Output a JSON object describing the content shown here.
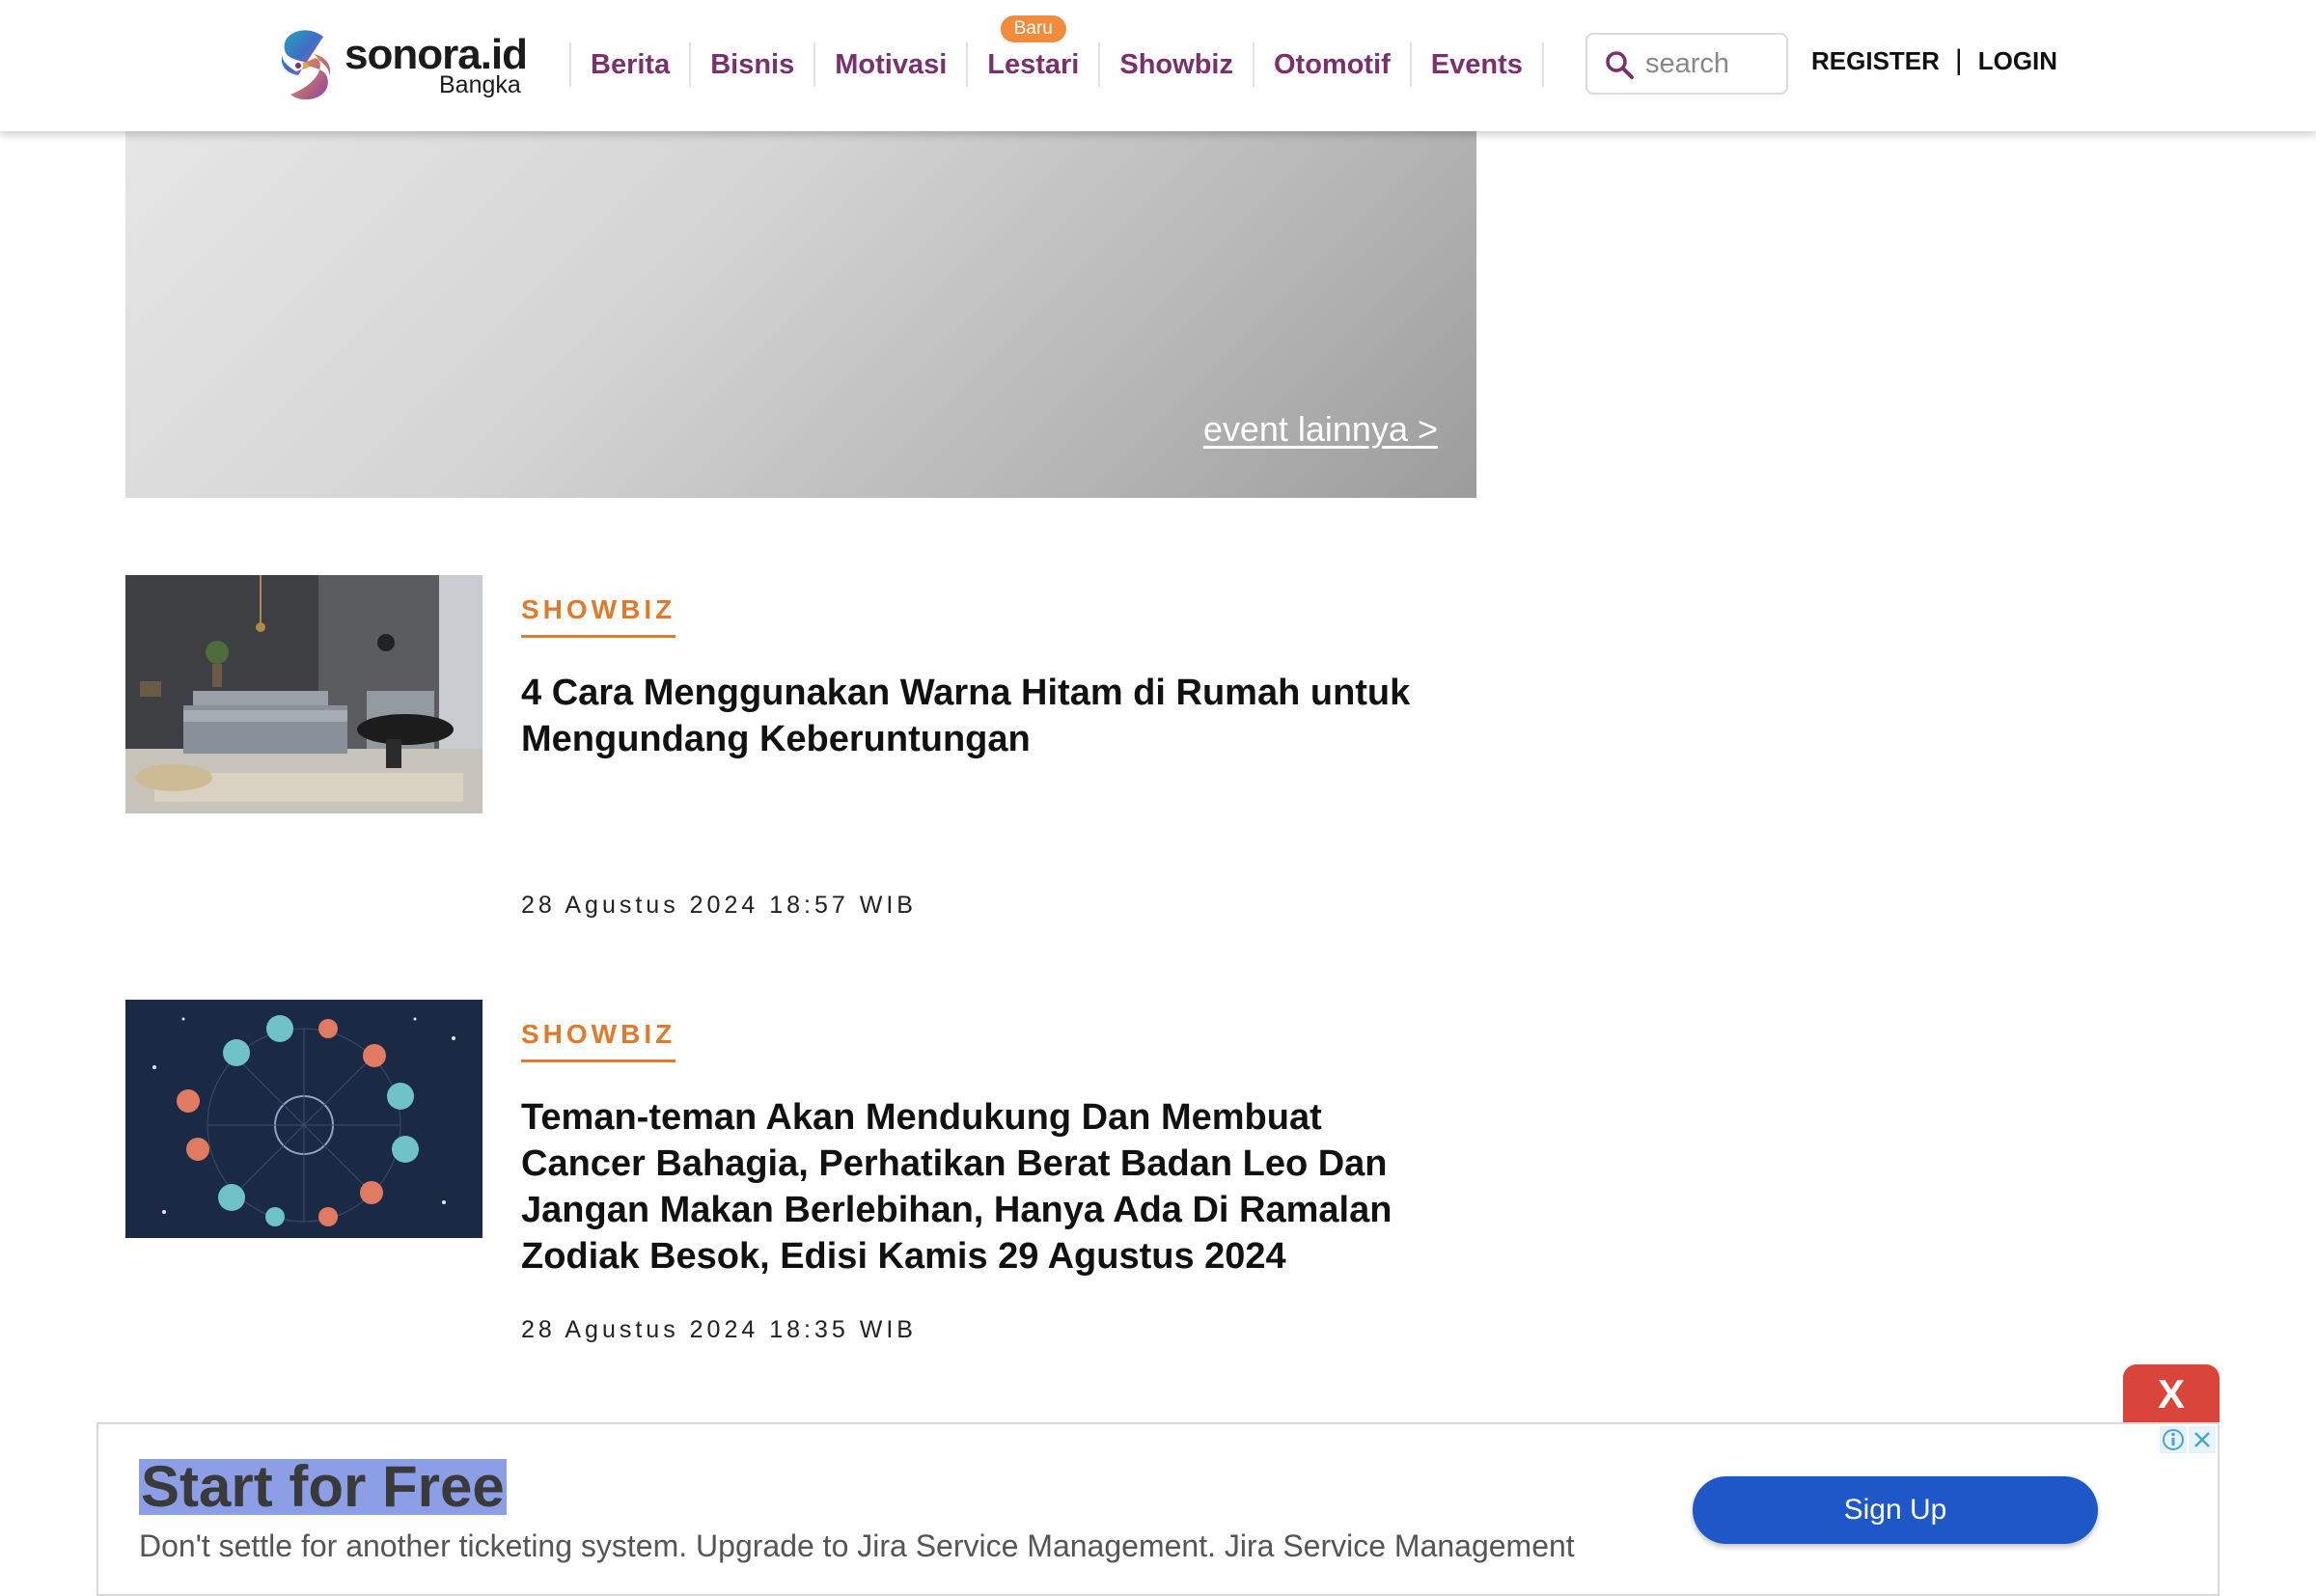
{
  "header": {
    "logo_text": "sonora.id",
    "logo_sub": "Bangka",
    "nav": [
      {
        "label": "Berita"
      },
      {
        "label": "Bisnis"
      },
      {
        "label": "Motivasi"
      },
      {
        "label": "Lestari",
        "badge": "Baru"
      },
      {
        "label": "Showbiz"
      },
      {
        "label": "Otomotif"
      },
      {
        "label": "Events"
      }
    ],
    "search": {
      "placeholder": "search"
    },
    "register_label": "REGISTER",
    "separator": "|",
    "login_label": "LOGIN"
  },
  "banner": {
    "link_label": "event lainnya >"
  },
  "articles": [
    {
      "category": "SHOWBIZ",
      "title": "4 Cara Menggunakan Warna Hitam di Rumah untuk Mengundang Keberuntungan",
      "date": "28 Agustus 2024 18:57 WIB",
      "image": "bedroom-photo"
    },
    {
      "category": "SHOWBIZ",
      "title": "Teman-teman Akan Mendukung Dan Membuat Cancer Bahagia, Perhatikan Berat Badan Leo Dan Jangan Makan Berlebihan, Hanya Ada Di Ramalan Zodiak Besok, Edisi Kamis 29 Agustus 2024",
      "date": "28 Agustus 2024 18:35 WIB",
      "image": "zodiac-wheel-illustration"
    }
  ],
  "ad": {
    "close_label": "X",
    "headline": "Start for Free",
    "body": "Don't settle for another ticketing system. Upgrade to Jira Service Management. Jira Service Management",
    "cta_label": "Sign Up",
    "icons": [
      "info-icon",
      "close-icon"
    ]
  },
  "colors": {
    "nav": "#7a2f6e",
    "category": "#e27a2c",
    "badge": "#f08c3c",
    "ad_close": "#d9453a",
    "ad_cta": "#1e58c8"
  }
}
